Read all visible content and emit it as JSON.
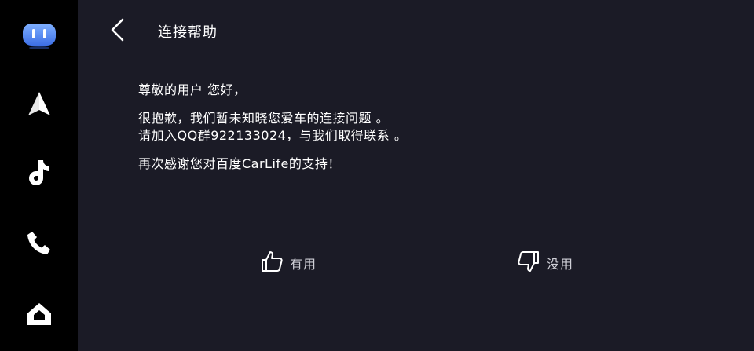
{
  "sidebar": {
    "items": [
      {
        "icon": "carlife-app-icon",
        "accent": "#4f86f7"
      },
      {
        "icon": "navigation-icon"
      },
      {
        "icon": "music-note-icon"
      },
      {
        "icon": "phone-icon"
      },
      {
        "icon": "home-icon"
      }
    ]
  },
  "header": {
    "title": "连接帮助",
    "back_icon": "chevron-left-icon"
  },
  "message": {
    "greeting": "尊敬的用户 您好，",
    "line1": "很抱歉，我们暂未知晓您爱车的连接问题 。",
    "line2": "请加入QQ群922133024，与我们取得联系 。",
    "closing": "再次感谢您对百度CarLife的支持！"
  },
  "feedback": {
    "useful_label": "有用",
    "useless_label": "没用",
    "useful_icon": "thumbs-up-icon",
    "useless_icon": "thumbs-down-icon"
  },
  "colors": {
    "background": "#1b1b26",
    "sidebar": "#000000",
    "text": "#ffffff",
    "muted_text": "#cfcfd6"
  }
}
